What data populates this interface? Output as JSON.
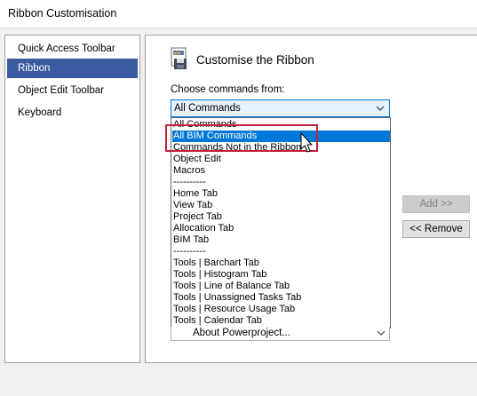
{
  "window": {
    "title": "Ribbon Customisation"
  },
  "nav": {
    "items": [
      {
        "label": "Quick Access Toolbar",
        "active": false
      },
      {
        "label": "Ribbon",
        "active": true
      },
      {
        "label": "Object Edit Toolbar",
        "active": false
      },
      {
        "label": "Keyboard",
        "active": false
      }
    ]
  },
  "main": {
    "header_title": "Customise the Ribbon",
    "choose_label": "Choose commands from:",
    "combo_value": "All Commands",
    "dropdown_options": [
      "All Commands",
      "All BIM Commands",
      "Commands Not in the Ribbon",
      "Object Edit",
      "Macros",
      "----------",
      "Home Tab",
      "View Tab",
      "Project Tab",
      "Allocation Tab",
      "BIM Tab",
      "----------",
      "Tools | Barchart Tab",
      "Tools | Histogram Tab",
      "Tools | Line of Balance Tab",
      "Tools | Unassigned Tasks Tab",
      "Tools | Resource Usage Tab",
      "Tools | Calendar Tab"
    ],
    "selected_option": "All BIM Commands",
    "second_combo_value": "About Powerproject...",
    "add_button": "Add >>",
    "remove_button": "<< Remove"
  },
  "colors": {
    "selection": "#0078d7",
    "nav_active": "#3a5ba0",
    "annotation_box": "#c0203c"
  }
}
